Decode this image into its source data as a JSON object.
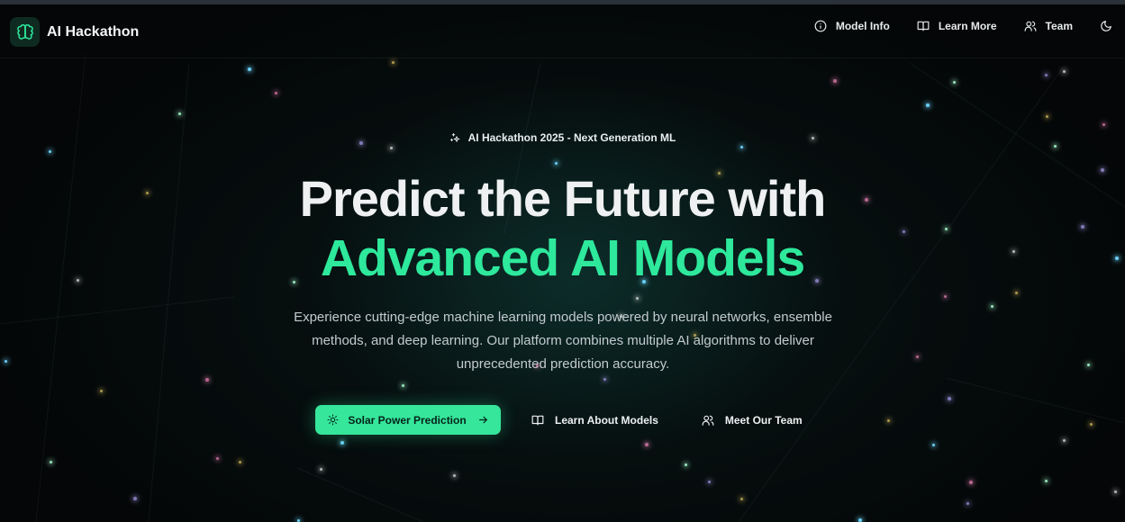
{
  "nav": {
    "brand_title": "AI Hackathon",
    "brand_icon": "brain-icon",
    "links": [
      {
        "label": "Model Info",
        "icon": "info-icon"
      },
      {
        "label": "Learn More",
        "icon": "book-icon"
      },
      {
        "label": "Team",
        "icon": "users-icon"
      }
    ],
    "theme_toggle_icon": "moon-icon"
  },
  "hero": {
    "badge": "AI Hackathon 2025 - Next Generation ML",
    "badge_icon": "sparkles-icon",
    "headline_line1": "Predict the Future with",
    "headline_line2": "Advanced AI Models",
    "description": "Experience cutting-edge machine learning models powered by neural networks, ensemble methods, and deep learning. Our platform combines multiple AI algorithms to deliver unprecedented prediction accuracy."
  },
  "cta": {
    "primary": {
      "label": "Solar Power Prediction",
      "icon": "sun-icon",
      "trailing_icon": "arrow-right-icon"
    },
    "secondary": {
      "label": "Learn About Models",
      "icon": "book-icon"
    },
    "tertiary": {
      "label": "Meet Our Team",
      "icon": "users-icon"
    }
  },
  "colors": {
    "accent": "#2ee89c",
    "button": "#35e69b",
    "background": "#040607",
    "headline": "#eef0f1"
  }
}
